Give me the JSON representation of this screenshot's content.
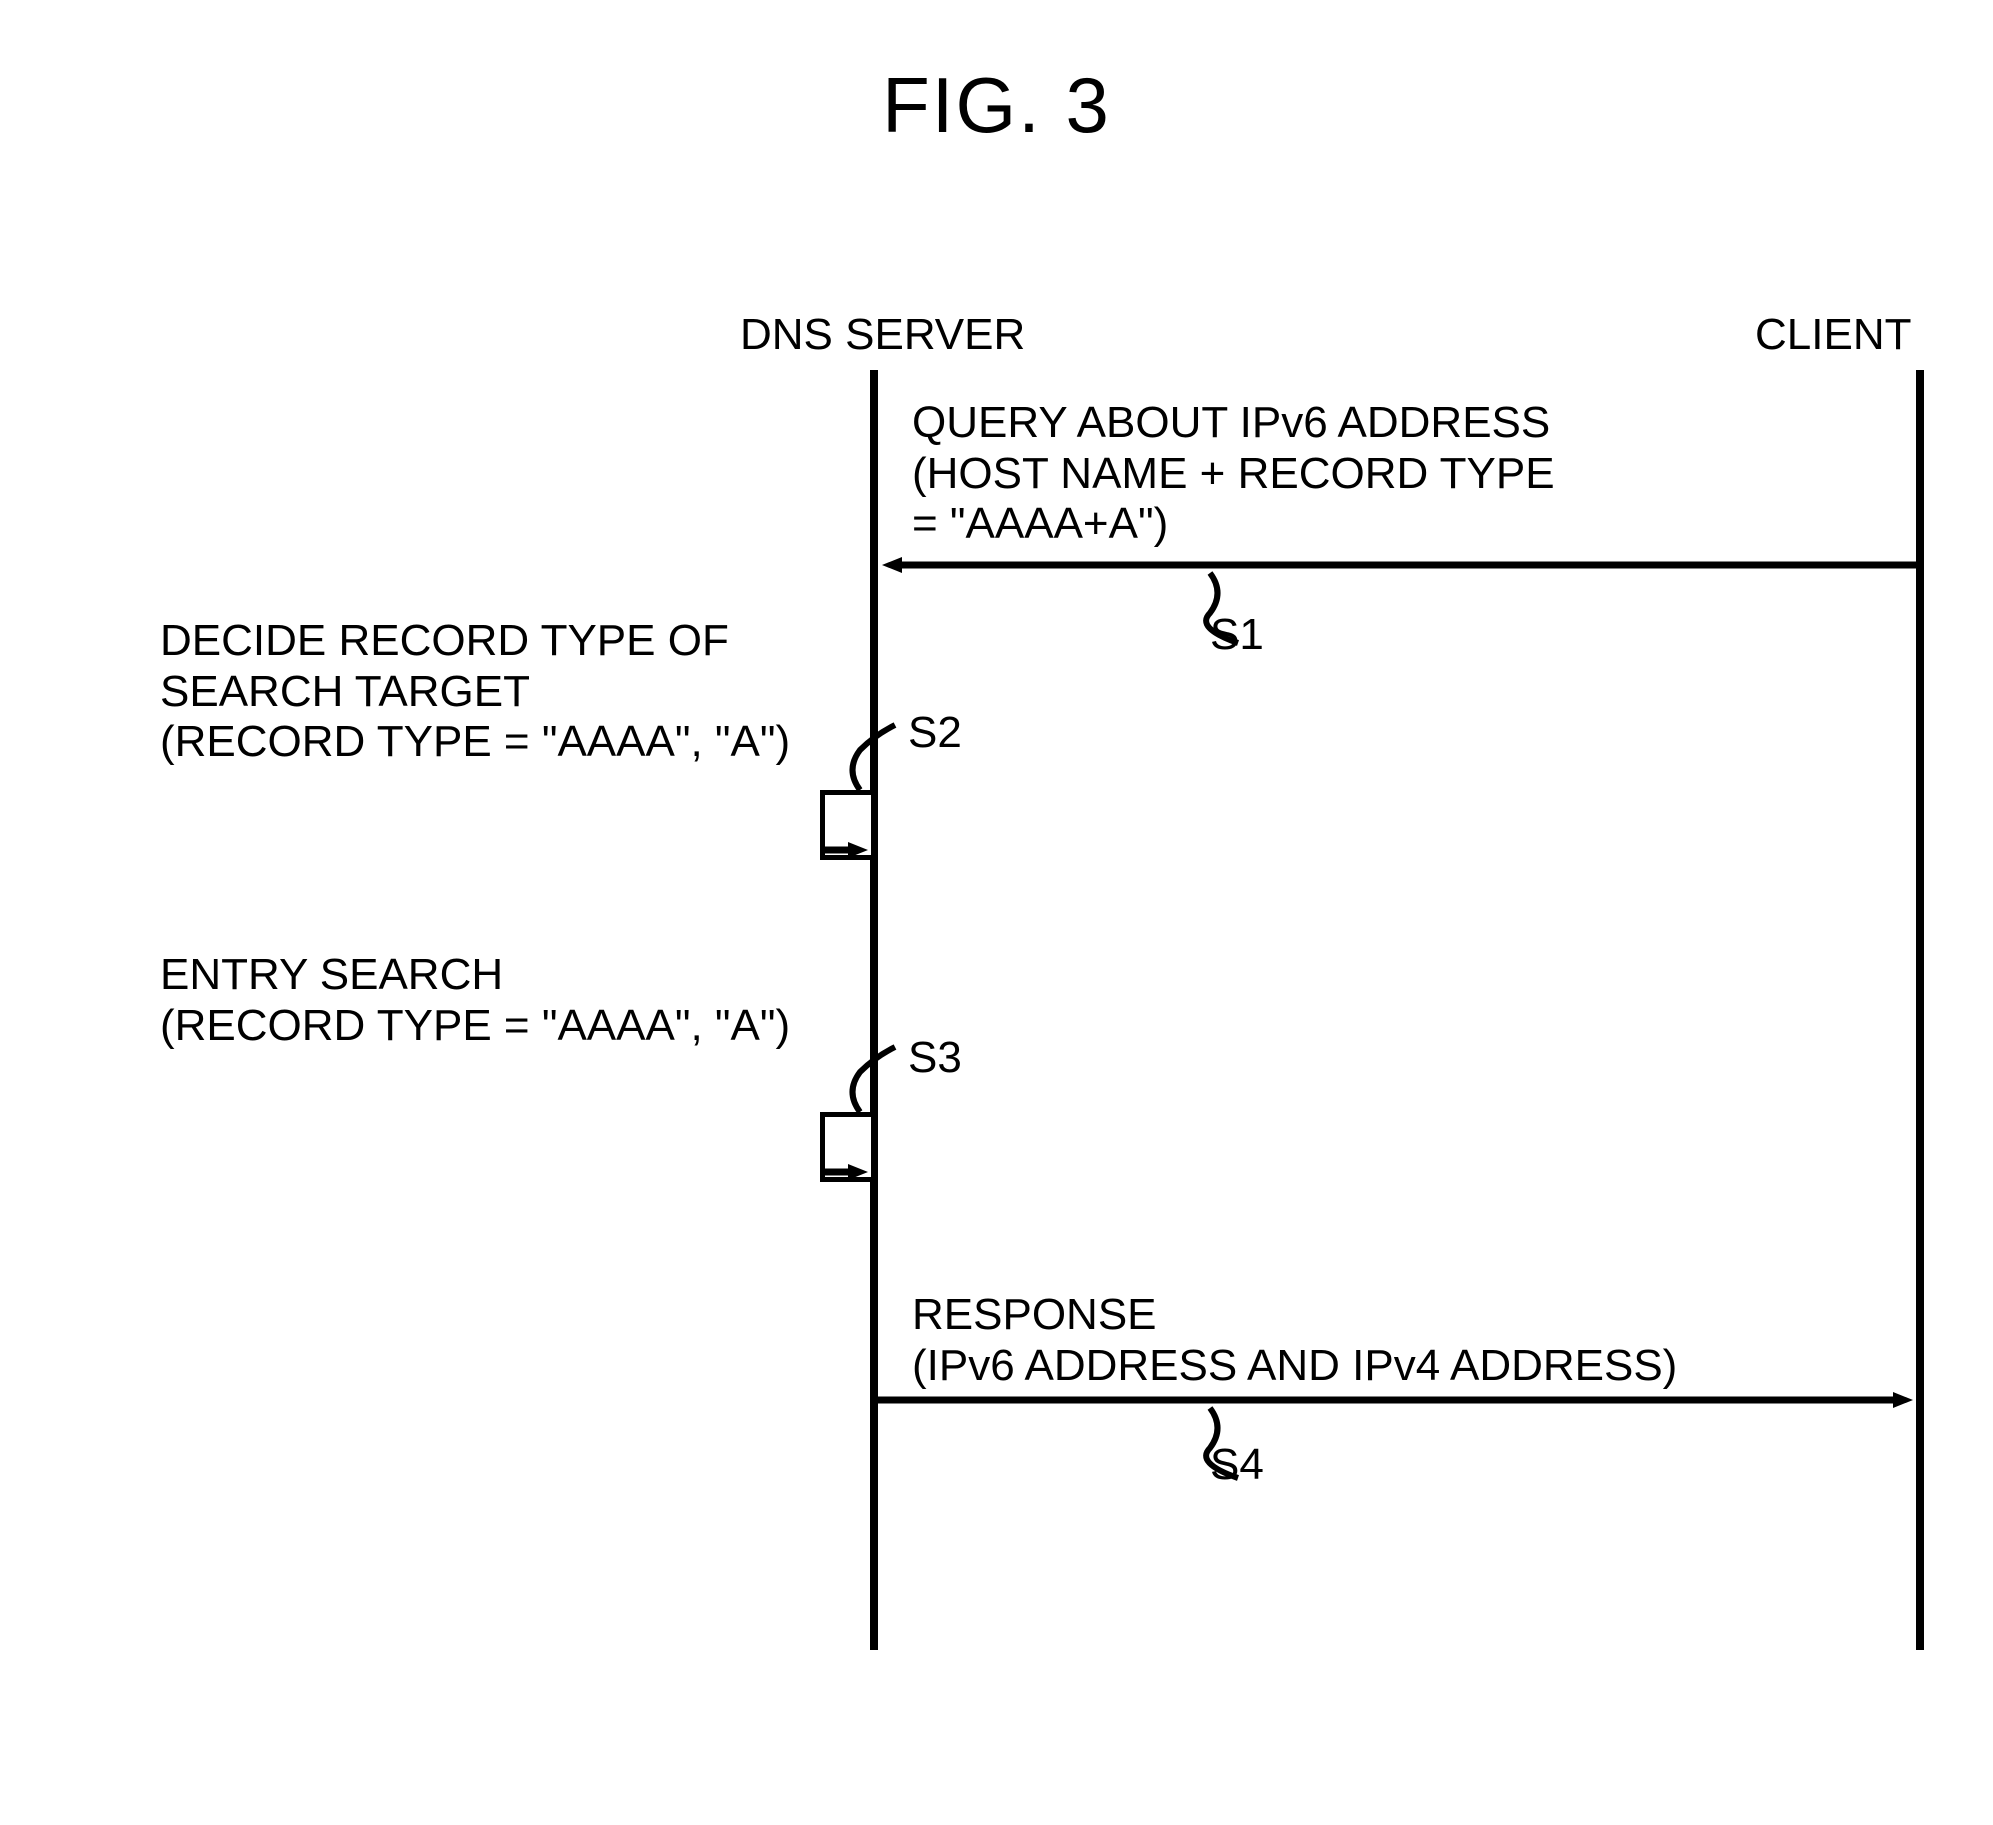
{
  "figure": {
    "title": "FIG. 3"
  },
  "lanes": {
    "server": "DNS SERVER",
    "client": "CLIENT"
  },
  "messages": {
    "s1": {
      "line1": "QUERY ABOUT IPv6 ADDRESS",
      "line2": "(HOST NAME + RECORD TYPE",
      "line3": "= \"AAAA+A\")",
      "step": "S1"
    },
    "s2": {
      "line1": "DECIDE RECORD TYPE OF",
      "line2": "SEARCH TARGET",
      "line3": "(RECORD TYPE = \"AAAA\", \"A\")",
      "step": "S2"
    },
    "s3": {
      "line1": "ENTRY SEARCH",
      "line2": "(RECORD TYPE = \"AAAA\", \"A\")",
      "step": "S3"
    },
    "s4": {
      "line1": "RESPONSE",
      "line2": "(IPv6 ADDRESS AND IPv4 ADDRESS)",
      "step": "S4"
    }
  }
}
